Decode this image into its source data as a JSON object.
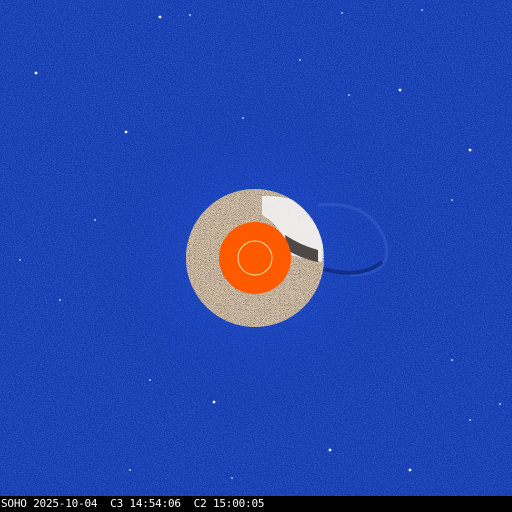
{
  "image": {
    "caption": "SOHO 2025-10-04  C3 14:54:06  C2 15:00:05"
  },
  "colors": {
    "background_blue": "#1238b0",
    "occulter_orange": "#ff5a00",
    "occulter_ring": "#ffe0a0",
    "inner_corona_light": "#f5efe8",
    "inner_corona_dark": "#3a2418"
  }
}
